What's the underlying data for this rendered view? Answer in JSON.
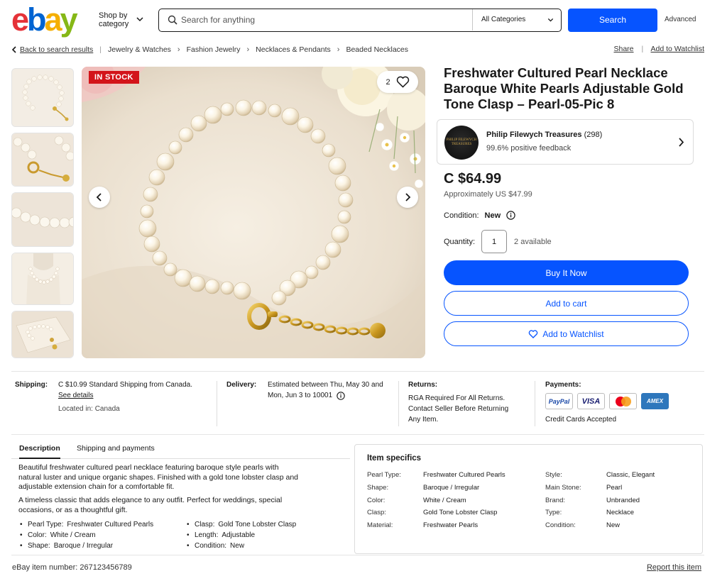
{
  "header": {
    "logo_letters": [
      "e",
      "b",
      "a",
      "y"
    ],
    "logo_colors": [
      "#e53238",
      "#0064d2",
      "#f5af02",
      "#86b817"
    ],
    "shop_by_category": "Shop by category",
    "search_placeholder": "Search for anything",
    "category_select": "All Categories",
    "search_button": "Search",
    "advanced_link": "Advanced"
  },
  "breadcrumbs": {
    "back": "Back to search results",
    "items": [
      "Jewelry & Watches",
      "Fashion Jewelry",
      "Necklaces & Pendants",
      "Beaded Necklaces"
    ],
    "share": "Share",
    "add_to_watchlist": "Add to Watchlist"
  },
  "gallery": {
    "stock_badge": "IN STOCK",
    "watch_count": "2",
    "thumbnail_count": 5
  },
  "product": {
    "title": "Freshwater Cultured Pearl Necklace Baroque White Pearls Adjustable Gold Tone Clasp – Pearl-05-Pic 8",
    "seller_name": "Philip Filewych Treasures",
    "seller_count": "(298)",
    "seller_feedback": "99.6% positive feedback",
    "seller_logo_text": "PHILIP FILEWYCH TREASURES",
    "price": "C $64.99",
    "approx_price": "Approximately US $47.99",
    "condition_label": "Condition:",
    "condition_value": "New",
    "quantity_label": "Quantity:",
    "quantity_value": "1",
    "available": "2 available",
    "buy_now": "Buy It Now",
    "add_to_cart": "Add to cart",
    "add_to_watchlist": "Add to Watchlist"
  },
  "shipping": {
    "shipping_label": "Shipping:",
    "shipping_text": "C $10.99  Standard Shipping from Canada.",
    "see_details": "See details",
    "located": "Located in: Canada",
    "delivery_label": "Delivery:",
    "delivery_line1": "Estimated between Thu, May 30 and",
    "delivery_line2": "Mon, Jun 3 to 10001",
    "returns_label": "Returns:",
    "returns_line1": "RGA Required For All Returns.",
    "returns_line2": "Contact Seller Before Returning",
    "returns_line3": "Any Item.",
    "payments_label": "Payments:",
    "payment_logos": [
      "PayPal",
      "VISA",
      "",
      "AMEX"
    ],
    "credit_cards": "Credit Cards Accepted"
  },
  "tabs": [
    "Description",
    "Shipping and payments"
  ],
  "description": {
    "para1": "Beautiful freshwater cultured pearl necklace featuring baroque style pearls with natural luster and unique organic shapes. Finished with a gold tone lobster clasp and adjustable extension chain for a comfortable fit.",
    "para2": "A timeless classic that adds elegance to any outfit. Perfect for weddings, special occasions, or as a thoughtful gift.",
    "bullets_left": [
      {
        "k": "Pearl Type:",
        "v": "Freshwater Cultured Pearls"
      },
      {
        "k": "Color:",
        "v": "White / Cream"
      },
      {
        "k": "Shape:",
        "v": "Baroque / Irregular"
      }
    ],
    "bullets_right": [
      {
        "k": "Clasp:",
        "v": "Gold Tone Lobster Clasp"
      },
      {
        "k": "Length:",
        "v": "Adjustable"
      },
      {
        "k": "Condition:",
        "v": "New"
      }
    ]
  },
  "item_specifics": {
    "heading": "Item specifics",
    "left": [
      {
        "k": "Pearl Type:",
        "v": "Freshwater Cultured Pearls"
      },
      {
        "k": "Shape:",
        "v": "Baroque / Irregular"
      },
      {
        "k": "Color:",
        "v": "White / Cream"
      },
      {
        "k": "Clasp:",
        "v": "Gold Tone Lobster Clasp"
      },
      {
        "k": "Material:",
        "v": "Freshwater Pearls"
      }
    ],
    "right": [
      {
        "k": "Style:",
        "v": "Classic, Elegant"
      },
      {
        "k": "Main Stone:",
        "v": "Pearl"
      },
      {
        "k": "Brand:",
        "v": "Unbranded"
      },
      {
        "k": "Type:",
        "v": "Necklace"
      },
      {
        "k": "Condition:",
        "v": "New"
      }
    ]
  },
  "footer": {
    "item_number": "eBay item number: 267123456789",
    "report": "Report this item"
  }
}
